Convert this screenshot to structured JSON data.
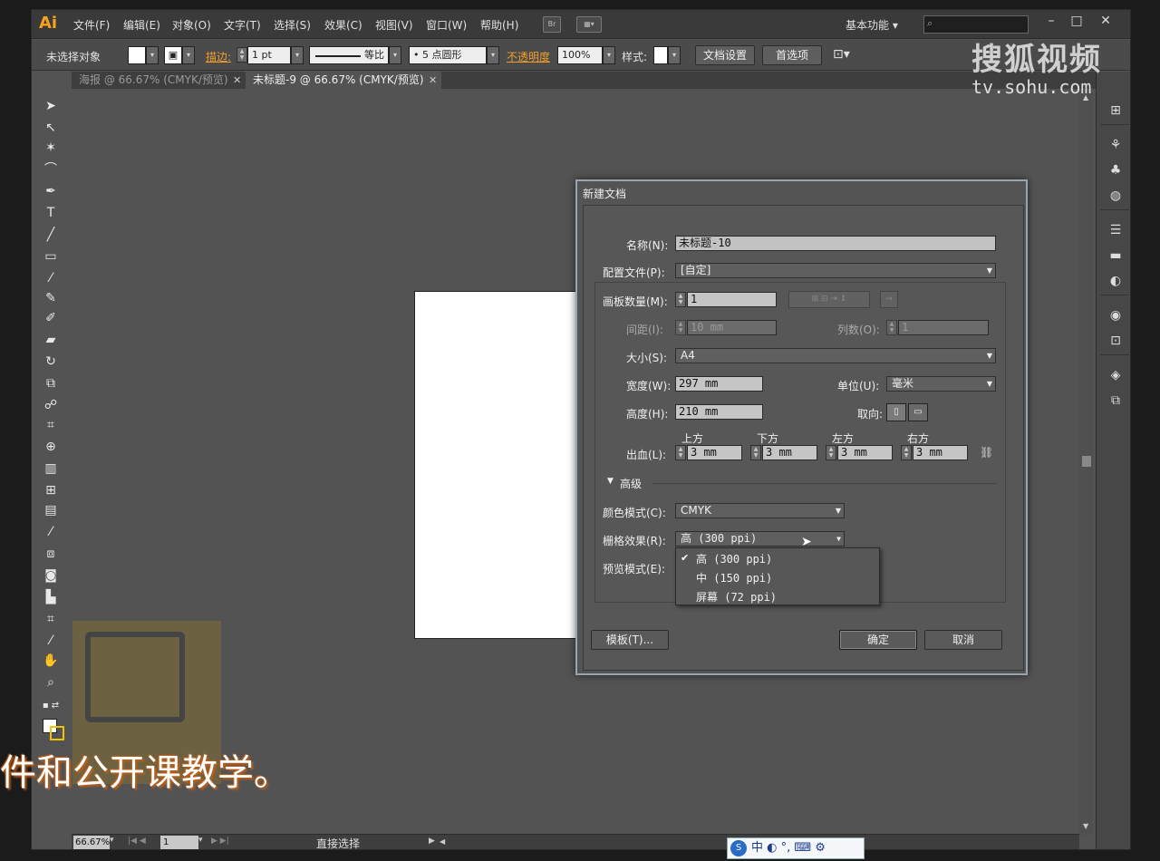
{
  "menubar": {
    "logo": "Ai",
    "items": [
      "文件(F)",
      "编辑(E)",
      "对象(O)",
      "文字(T)",
      "选择(S)",
      "效果(C)",
      "视图(V)",
      "窗口(W)",
      "帮助(H)"
    ],
    "bridge_label": "Br",
    "workspace": "基本功能",
    "window_controls": [
      "–",
      "□",
      "✕"
    ]
  },
  "control_bar": {
    "selection_status": "未选择对象",
    "stroke_label": "描边:",
    "stroke_value": "1 pt",
    "stroke_style": "等比",
    "brush": "5 点圆形",
    "opacity_label": "不透明度",
    "opacity_value": "100%",
    "style_label": "样式:",
    "doc_setup_button": "文档设置",
    "prefs_button": "首选项"
  },
  "tabs": [
    {
      "label": "海报 @ 66.67% (CMYK/预览)",
      "active": false
    },
    {
      "label": "未标题-9 @ 66.67% (CMYK/预览)",
      "active": true
    }
  ],
  "watermark": {
    "brand": "搜狐视频",
    "url": "tv.sohu.com"
  },
  "dialog": {
    "title": "新建文档",
    "name_label": "名称(N):",
    "name_value": "未标题-10",
    "profile_label": "配置文件(P):",
    "profile_value": "[自定]",
    "artboards_label": "画板数量(M):",
    "artboards_value": "1",
    "spacing_label": "间距(I):",
    "spacing_value": "10 mm",
    "columns_label": "列数(O):",
    "columns_value": "1",
    "size_label": "大小(S):",
    "size_value": "A4",
    "width_label": "宽度(W):",
    "width_value": "297 mm",
    "units_label": "单位(U):",
    "units_value": "毫米",
    "height_label": "高度(H):",
    "height_value": "210 mm",
    "orientation_label": "取向:",
    "bleed_label": "出血(L):",
    "bleed": [
      {
        "side": "上方",
        "value": "3 mm"
      },
      {
        "side": "下方",
        "value": "3 mm"
      },
      {
        "side": "左方",
        "value": "3 mm"
      },
      {
        "side": "右方",
        "value": "3 mm"
      }
    ],
    "advanced_label": "高级",
    "color_mode_label": "颜色模式(C):",
    "color_mode_value": "CMYK",
    "raster_label": "栅格效果(R):",
    "raster_value": "高 (300 ppi)",
    "preview_label": "预览模式(E):",
    "raster_options": [
      {
        "label": "高 (300 ppi)",
        "checked": true
      },
      {
        "label": "中 (150 ppi)",
        "checked": false
      },
      {
        "label": "屏幕 (72 ppi)",
        "checked": false
      }
    ],
    "templates_button": "模板(T)...",
    "ok_button": "确定",
    "cancel_button": "取消"
  },
  "status_bar": {
    "zoom": "66.67%",
    "page": "1",
    "tool_status": "直接选择"
  },
  "subtitle": "件和公开课教学。",
  "ime": "中 ◐ °, ⌨ ⚙",
  "colors": {
    "app_bg": "#535353",
    "accent_orange": "#f29d2a",
    "dialog_border": "#9aa4b0"
  }
}
